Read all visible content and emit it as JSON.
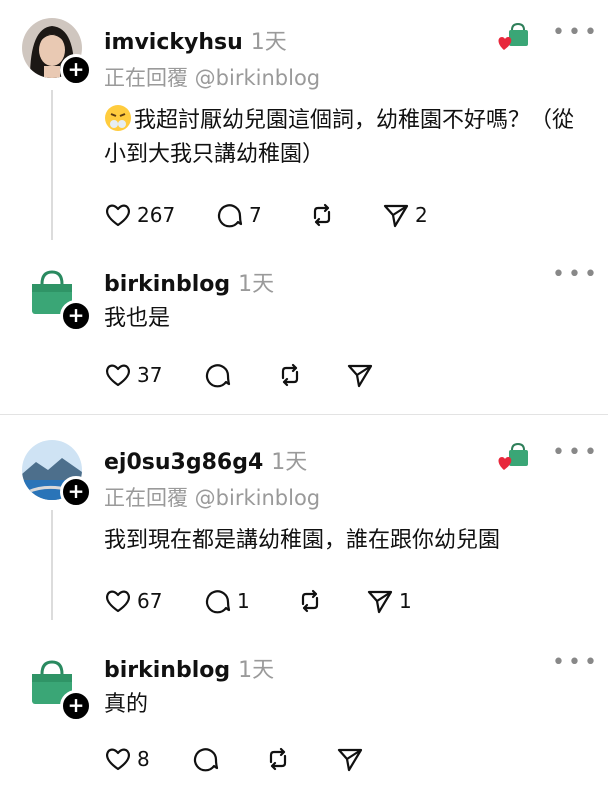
{
  "posts": [
    {
      "username": "imvickyhsu",
      "time": "1天",
      "replying": "正在回覆 @birkinblog",
      "text": "我超討厭幼兒園這個詞，幼稚園不好嗎？（從小到大我只講幼稚園）",
      "likes": "267",
      "comments": "7",
      "reposts": "",
      "shares": "2"
    },
    {
      "username": "birkinblog",
      "time": "1天",
      "text": "我也是",
      "likes": "37",
      "comments": "",
      "reposts": "",
      "shares": ""
    },
    {
      "username": "ej0su3g86g4",
      "time": "1天",
      "replying": "正在回覆 @birkinblog",
      "text": "我到現在都是講幼稚園，誰在跟你幼兒園",
      "likes": "67",
      "comments": "1",
      "reposts": "",
      "shares": "1"
    },
    {
      "username": "birkinblog",
      "time": "1天",
      "text": "真的",
      "likes": "8",
      "comments": "",
      "reposts": "",
      "shares": ""
    }
  ],
  "icons": {
    "like": "heart-icon",
    "comment": "comment-bubble-icon",
    "repost": "repost-icon",
    "share": "share-send-icon",
    "more": "more-dots-icon",
    "follow": "plus-icon",
    "liked_by_author": "bag-heart-icon",
    "emoji": "steam-nose-emoji-icon"
  },
  "colors": {
    "text": "#111111",
    "secondary": "#9a9a9a",
    "bag_green": "#3aa676",
    "heart_red": "#e8283c"
  }
}
